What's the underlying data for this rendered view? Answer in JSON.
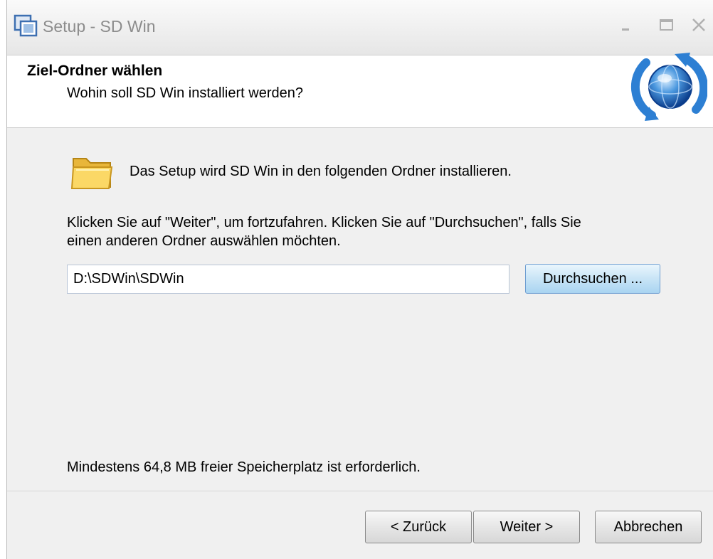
{
  "window": {
    "title": "Setup - SD Win",
    "icons": {
      "app": "setup-app-icon",
      "minimize": "minimize-icon",
      "maximize": "maximize-icon",
      "close": "close-icon"
    }
  },
  "header": {
    "title": "Ziel-Ordner wählen",
    "subtitle": "Wohin soll SD Win installiert werden?",
    "icon": "globe-refresh-icon"
  },
  "content": {
    "folder_icon": "folder-icon",
    "intro_text": "Das Setup wird SD Win in den folgenden Ordner installieren.",
    "instruction_line1": "Klicken Sie auf \"Weiter\", um fortzufahren. Klicken Sie auf \"Durchsuchen\", falls Sie",
    "instruction_line2": "einen anderen Ordner auswählen möchten.",
    "path_value": "D:\\SDWin\\SDWin",
    "browse_label": "Durchsuchen ...",
    "space_required": "Mindestens 64,8 MB freier Speicherplatz ist erforderlich."
  },
  "footer": {
    "back_label": "< Zurück",
    "next_label": "Weiter >",
    "cancel_label": "Abbrechen"
  },
  "colors": {
    "title_text": "#8c8c8c",
    "focused_button": "#a9d4f1",
    "dialog_bg": "#f0f0f0"
  }
}
